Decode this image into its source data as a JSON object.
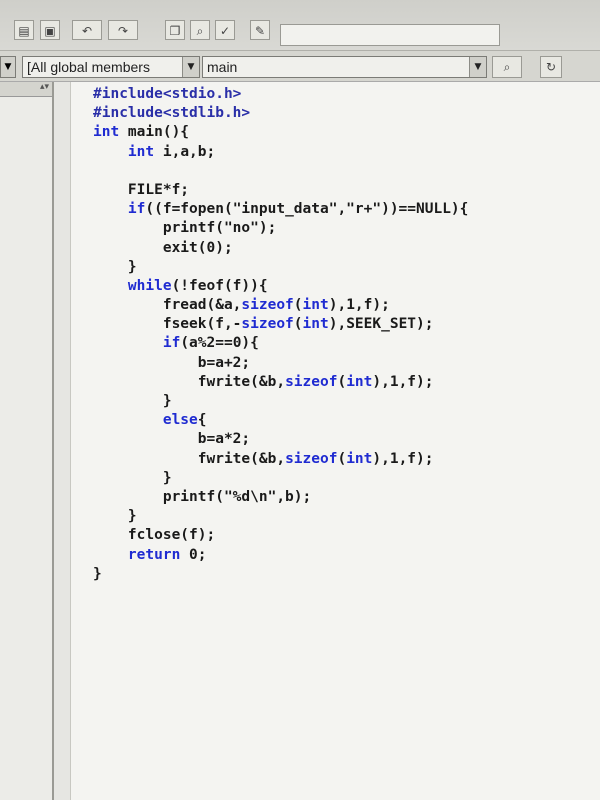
{
  "toolbar": {
    "icons": [
      "save-all-icon",
      "undo-icon",
      "redo-icon",
      "window-icon",
      "find-icon",
      "bookmark-icon"
    ]
  },
  "combos": {
    "scope_value": "[All global members",
    "member_value": "main"
  },
  "editor": {
    "lines": [
      "#include<stdio.h>",
      "#include<stdlib.h>",
      "int main(){",
      "    int i,a,b;",
      "",
      "    FILE*f;",
      "    if((f=fopen(\"input_data\",\"r+\"))==NULL){",
      "        printf(\"no\");",
      "        exit(0);",
      "    }",
      "    while(!feof(f)){",
      "        fread(&a,sizeof(int),1,f);",
      "        fseek(f,-sizeof(int),SEEK_SET);",
      "        if(a%2==0){",
      "            b=a+2;",
      "            fwrite(&b,sizeof(int),1,f);",
      "        }",
      "        else{",
      "            b=a*2;",
      "            fwrite(&b,sizeof(int),1,f);",
      "        }",
      "        printf(\"%d\\n\",b);",
      "    }",
      "    fclose(f);",
      "    return 0;",
      "}"
    ]
  },
  "colors": {
    "keyword": "#1f2bd1",
    "preprocessor": "#2a2fa8",
    "text": "#1a1a1a"
  }
}
